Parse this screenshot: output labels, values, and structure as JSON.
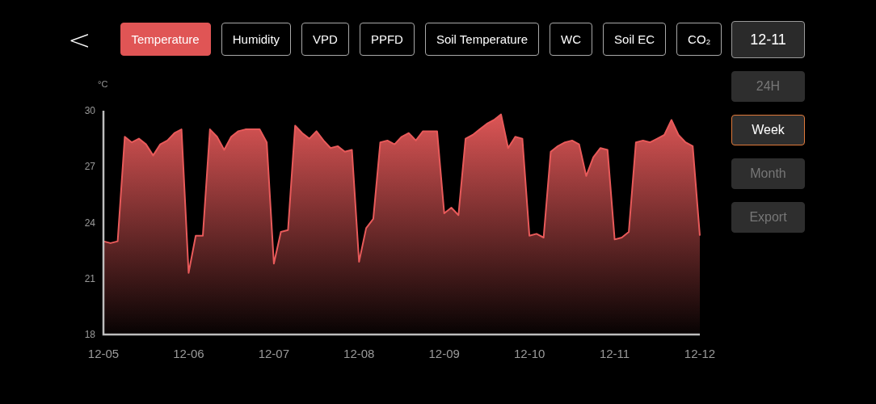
{
  "back_button": {
    "label": "<"
  },
  "tabs": [
    {
      "label": "Temperature",
      "selected": true
    },
    {
      "label": "Humidity",
      "selected": false
    },
    {
      "label": "VPD",
      "selected": false
    },
    {
      "label": "PPFD",
      "selected": false
    },
    {
      "label": "Soil Temperature",
      "selected": false
    },
    {
      "label": "WC",
      "selected": false
    },
    {
      "label": "Soil EC",
      "selected": false
    },
    {
      "label": "CO₂",
      "selected": false
    }
  ],
  "date_button": {
    "label": "12-11"
  },
  "ranges": [
    {
      "label": "24H",
      "selected": false
    },
    {
      "label": "Week",
      "selected": true
    },
    {
      "label": "Month",
      "selected": false
    }
  ],
  "export_button": {
    "label": "Export"
  },
  "chart": {
    "chart_data": {
      "type": "area",
      "ylabel": "°C",
      "ylim": [
        18,
        30
      ],
      "categories": [
        "12-05",
        null,
        null,
        null,
        null,
        null,
        null,
        null,
        null,
        null,
        null,
        null,
        "12-06",
        null,
        null,
        null,
        null,
        null,
        null,
        null,
        null,
        null,
        null,
        null,
        "12-07",
        null,
        null,
        null,
        null,
        null,
        null,
        null,
        null,
        null,
        null,
        null,
        "12-08",
        null,
        null,
        null,
        null,
        null,
        null,
        null,
        null,
        null,
        null,
        null,
        "12-09",
        null,
        null,
        null,
        null,
        null,
        null,
        null,
        null,
        null,
        null,
        null,
        "12-10",
        null,
        null,
        null,
        null,
        null,
        null,
        null,
        null,
        null,
        null,
        null,
        "12-11",
        null,
        null,
        null,
        null,
        null,
        null,
        null,
        null,
        null,
        null,
        null,
        "12-12"
      ],
      "yticks": [
        18,
        21,
        24,
        27,
        30
      ],
      "series": [
        {
          "color": "#e85a5a",
          "values": [
            23.0,
            22.9,
            23.0,
            28.6,
            28.3,
            28.5,
            28.2,
            27.6,
            28.2,
            28.4,
            28.8,
            29.0,
            21.3,
            23.3,
            23.3,
            29.0,
            28.6,
            27.9,
            28.6,
            28.9,
            29.0,
            29.0,
            29.0,
            28.3,
            21.8,
            23.5,
            23.6,
            29.2,
            28.8,
            28.5,
            28.9,
            28.4,
            28.0,
            28.1,
            27.8,
            27.9,
            21.9,
            23.7,
            24.2,
            28.3,
            28.4,
            28.2,
            28.6,
            28.8,
            28.4,
            28.9,
            28.9,
            28.9,
            24.5,
            24.8,
            24.4,
            28.5,
            28.7,
            29.0,
            29.3,
            29.5,
            29.8,
            28.0,
            28.6,
            28.5,
            23.3,
            23.4,
            23.2,
            27.8,
            28.1,
            28.3,
            28.4,
            28.2,
            26.5,
            27.5,
            28.0,
            27.9,
            23.1,
            23.2,
            23.5,
            28.3,
            28.4,
            28.3,
            28.5,
            28.7,
            29.5,
            28.7,
            28.3,
            28.1,
            23.3
          ]
        }
      ]
    }
  }
}
